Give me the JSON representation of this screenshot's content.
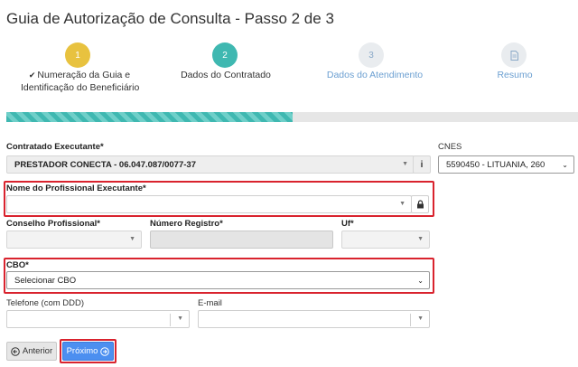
{
  "page": {
    "title": "Guia de Autorização de Consulta - Passo 2 de 3"
  },
  "steps": [
    {
      "number": "1",
      "label_line1": "Numeração da Guia e",
      "label_line2": "Identificação do Beneficiário",
      "status": "completed"
    },
    {
      "number": "2",
      "label_line1": "Dados do Contratado",
      "status": "current"
    },
    {
      "number": "3",
      "label_line1": "Dados do Atendimento",
      "status": "pending"
    },
    {
      "number": "",
      "icon": "document-icon",
      "label_line1": "Resumo",
      "status": "pending"
    }
  ],
  "progress": {
    "percent": 50
  },
  "form": {
    "contratado": {
      "label": "Contratado Executante*",
      "value": "PRESTADOR CONECTA - 06.047.087/0077-37",
      "info_icon": "i"
    },
    "cnes": {
      "label": "CNES",
      "value": "5590450 - LITUANIA, 260"
    },
    "profissional": {
      "label": "Nome do Profissional Executante*",
      "value": ""
    },
    "conselho": {
      "label": "Conselho Profissional*",
      "value": ""
    },
    "registro": {
      "label": "Número Registro*",
      "value": ""
    },
    "uf": {
      "label": "Uf*",
      "value": ""
    },
    "cbo": {
      "label": "CBO*",
      "value": "Selecionar CBO"
    },
    "telefone": {
      "label": "Telefone (com DDD)",
      "value": ""
    },
    "email": {
      "label": "E-mail",
      "value": ""
    }
  },
  "buttons": {
    "anterior": "Anterior",
    "proximo": "Próximo"
  },
  "colors": {
    "step_done": "#e8c23f",
    "step_current": "#3fb8b1",
    "step_pending": "#e9ecef",
    "primary": "#4c8ff0",
    "highlight": "#d9232e"
  }
}
